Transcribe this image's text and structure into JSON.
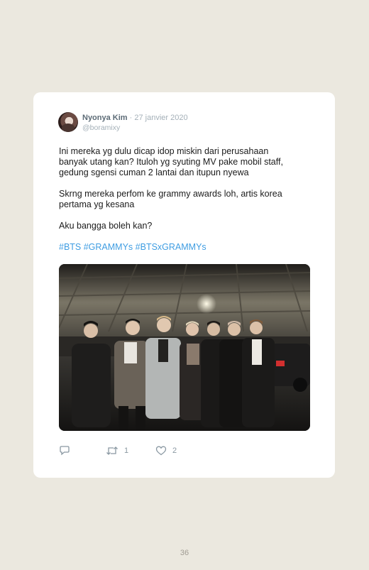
{
  "tweet": {
    "display_name": "Nyonya Kim",
    "date": "· 27 janvier 2020",
    "handle": "@boramixy",
    "paragraphs": [
      "Ini mereka yg dulu dicap idop miskin dari perusahaan\nbanyak utang kan? Ituloh yg syuting MV pake mobil staff,\ngedung sgensi cuman 2 lantai dan itupun nyewa",
      "Skrng mereka perfom ke grammy awards loh, artis korea\npertama yg kesana",
      "Aku bangga boleh kan?"
    ],
    "hashtags": "#BTS #GRAMMYs #BTSxGRAMMYs",
    "retweet_count": "1",
    "like_count": "2"
  },
  "icons": {
    "reply": "reply-icon",
    "retweet": "retweet-icon",
    "like": "heart-icon"
  },
  "colors": {
    "page_background": "#ebe8df",
    "card_background": "#ffffff",
    "hashtag": "#3f9de2",
    "muted": "#a4b0b8"
  },
  "page_number": "36"
}
